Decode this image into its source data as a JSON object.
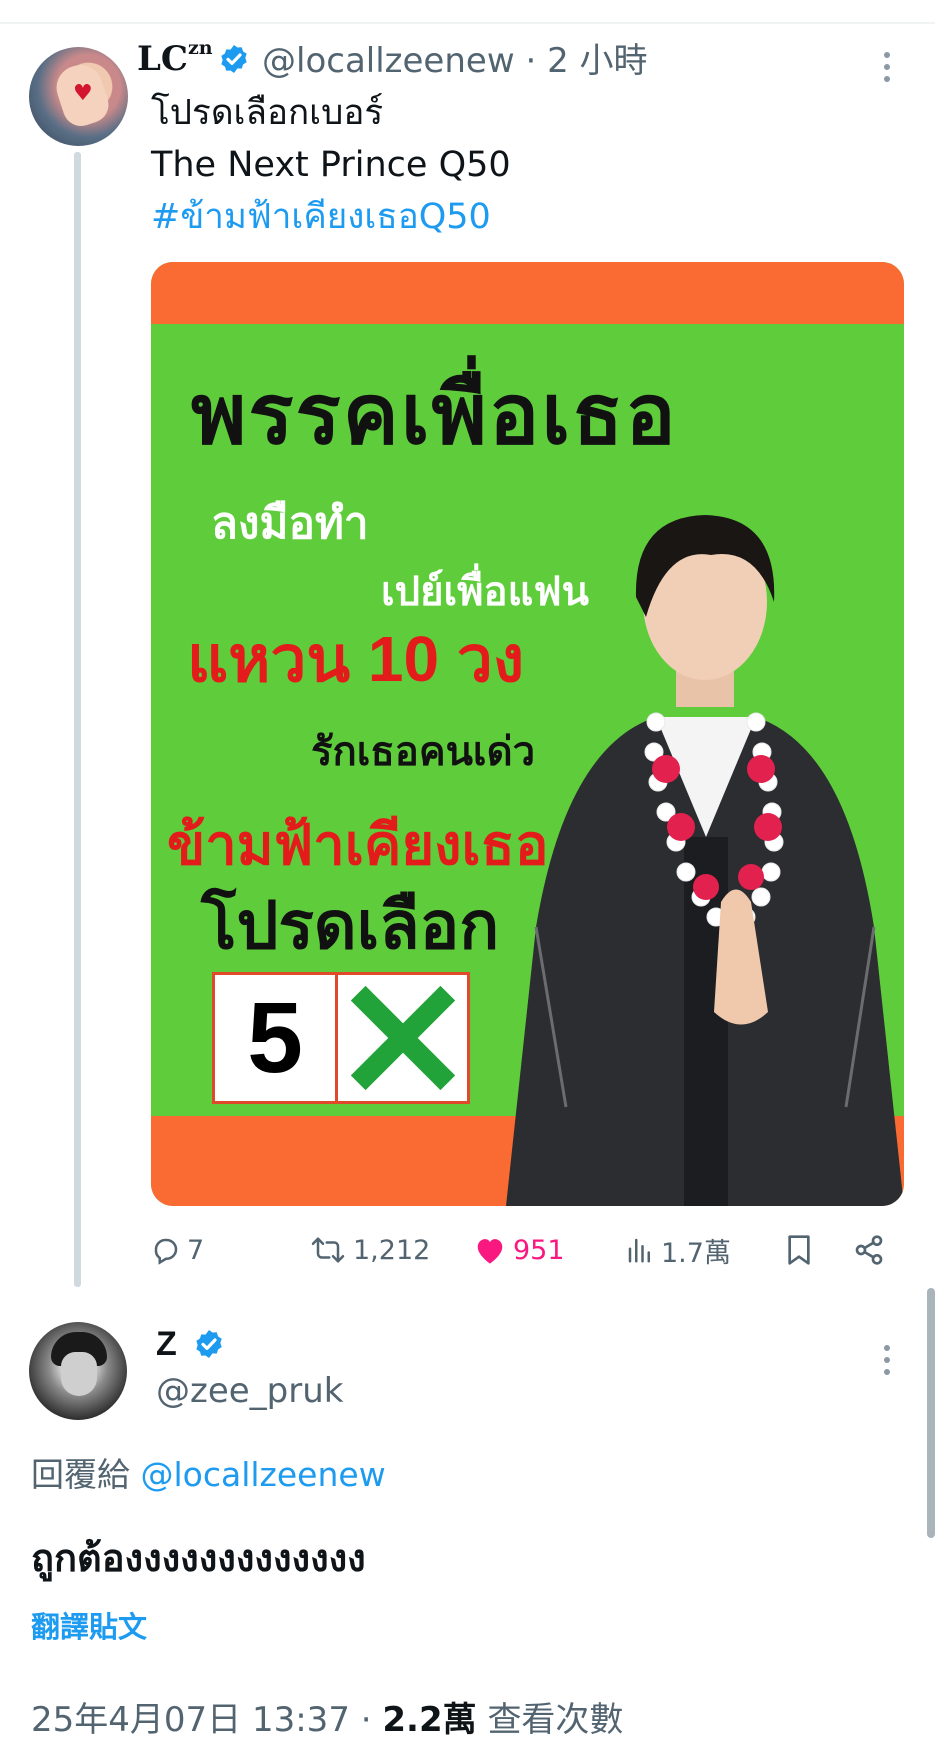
{
  "tweet": {
    "author_name": "LC",
    "author_name_superscript": "zn",
    "handle": "@locallzeenew",
    "separator": "·",
    "time": "2 小時",
    "text_lines": [
      "โปรดเลือกเบอร์",
      "The Next Prince Q50"
    ],
    "hashtag": "#ข้ามฟ้าเคียงเธอQ50",
    "poster": {
      "title": "พรรคเพื่อเธอ",
      "line1": "ลงมือทำ",
      "line2": "เปย์เพื่อแฟน",
      "line3": "แหวน 10 วง",
      "line4": "รักเธอคนเด่ว",
      "line5": "ข้ามฟ้าเคียงเธอ",
      "line6": "โปรดเลือก",
      "ballot_number": "5"
    },
    "actions": {
      "replies": "7",
      "retweets": "1,212",
      "likes": "951",
      "views": "1.7萬"
    }
  },
  "reply": {
    "author_name": "Z",
    "handle": "@zee_pruk",
    "reply_prefix": "回覆給",
    "reply_mention": "@locallzeenew",
    "text": "ถูกต้องงงงงงงงงงงงง",
    "translate_label": "翻譯貼文",
    "timestamp": "25年4月07日 13:37",
    "separator": "·",
    "views_count": "2.2萬",
    "views_label": "查看次數"
  },
  "colors": {
    "accent": "#1d9bf0",
    "like": "#f91880",
    "secondary_text": "#536471",
    "poster_green": "#5fcc3c",
    "poster_orange": "#fa6a33"
  }
}
